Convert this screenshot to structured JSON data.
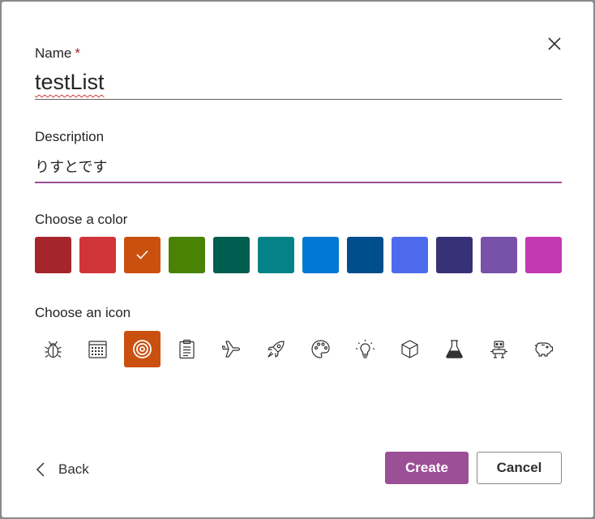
{
  "form": {
    "name_label": "Name",
    "required_marker": "*",
    "name_value": "testList",
    "description_label": "Description",
    "description_value": "りすとです",
    "color_label": "Choose a color",
    "icon_label": "Choose an icon",
    "accent_color": "#9b4f96"
  },
  "colors": [
    {
      "hex": "#a4262c",
      "selected": false
    },
    {
      "hex": "#d13438",
      "selected": false
    },
    {
      "hex": "#ca5010",
      "selected": true
    },
    {
      "hex": "#498205",
      "selected": false
    },
    {
      "hex": "#005e50",
      "selected": false
    },
    {
      "hex": "#038387",
      "selected": false
    },
    {
      "hex": "#0078d4",
      "selected": false
    },
    {
      "hex": "#004e8c",
      "selected": false
    },
    {
      "hex": "#4f6bed",
      "selected": false
    },
    {
      "hex": "#373277",
      "selected": false
    },
    {
      "hex": "#7851a9",
      "selected": false
    },
    {
      "hex": "#c239b3",
      "selected": false
    }
  ],
  "icons": [
    {
      "name": "bug-icon",
      "selected": false
    },
    {
      "name": "calendar-icon",
      "selected": false
    },
    {
      "name": "target-icon",
      "selected": true
    },
    {
      "name": "clipboard-icon",
      "selected": false
    },
    {
      "name": "airplane-icon",
      "selected": false
    },
    {
      "name": "rocket-icon",
      "selected": false
    },
    {
      "name": "palette-icon",
      "selected": false
    },
    {
      "name": "lightbulb-icon",
      "selected": false
    },
    {
      "name": "cube-icon",
      "selected": false
    },
    {
      "name": "beaker-icon",
      "selected": false
    },
    {
      "name": "robot-icon",
      "selected": false
    },
    {
      "name": "piggy-bank-icon",
      "selected": false
    }
  ],
  "footer": {
    "back_label": "Back",
    "create_label": "Create",
    "cancel_label": "Cancel"
  }
}
